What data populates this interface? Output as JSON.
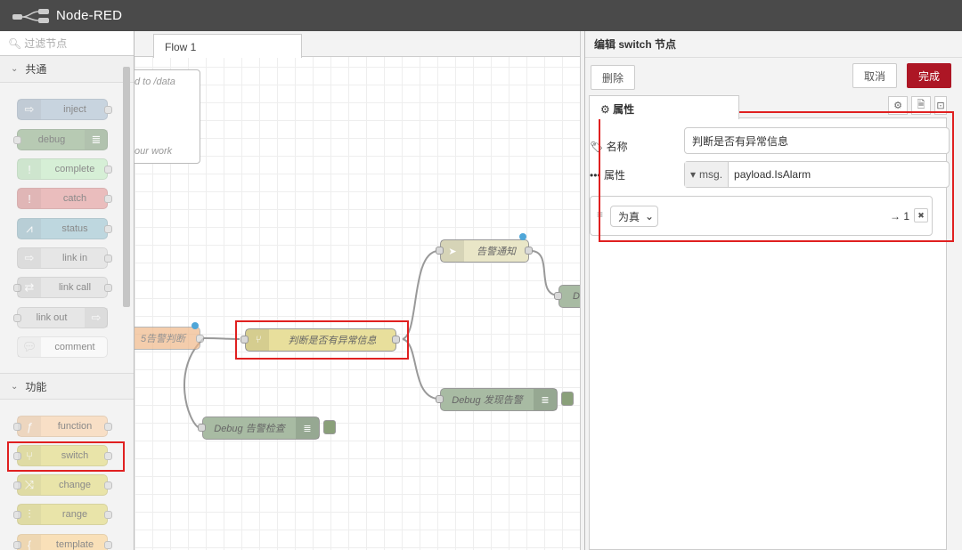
{
  "header": {
    "title": "Node-RED"
  },
  "palette": {
    "search_placeholder": "过滤节点",
    "categories": [
      {
        "label": "共通"
      },
      {
        "label": "功能"
      }
    ],
    "common_nodes": [
      {
        "label": "inject",
        "color": "#a6bbcf"
      },
      {
        "label": "debug",
        "color": "#87a980"
      },
      {
        "label": "complete",
        "color": "#c0edc0"
      },
      {
        "label": "catch",
        "color": "#e49191"
      },
      {
        "label": "status",
        "color": "#94c1d0"
      },
      {
        "label": "link in",
        "color": "#dddddd"
      },
      {
        "label": "link call",
        "color": "#dddddd"
      },
      {
        "label": "link out",
        "color": "#dddddd"
      },
      {
        "label": "comment",
        "color": "#ffffff"
      }
    ],
    "function_nodes": [
      {
        "label": "function",
        "color": "#fdd0a2"
      },
      {
        "label": "switch",
        "color": "#e2d96e"
      },
      {
        "label": "change",
        "color": "#e2d96e"
      },
      {
        "label": "range",
        "color": "#e2d96e"
      },
      {
        "label": "template",
        "color": "#ffd289"
      }
    ]
  },
  "workspace": {
    "tab_label": "Flow 1",
    "comment_lines": [
      "d to /data",
      "our work"
    ],
    "nodes": {
      "left_node": "5告警判断",
      "switch_node": "判断是否有异常信息",
      "alarm_notify": "告警通知",
      "debug_found": "Debug 发现告警",
      "debug_check": "Debug 告警检查",
      "debug_right": "D"
    }
  },
  "editor": {
    "title": "编辑 switch 节点",
    "delete_label": "删除",
    "cancel_label": "取消",
    "done_label": "完成",
    "properties_tab": "属性",
    "name_label": "名称",
    "name_value": "判断是否有异常信息",
    "property_label": "属性",
    "property_type": "msg.",
    "property_value": "payload.IsAlarm",
    "rule_operator": "为真",
    "rule_output": "→ 1"
  },
  "colors": {
    "accent": "#ad1625",
    "highlight": "#e02020",
    "header": "#4a4a4a"
  }
}
